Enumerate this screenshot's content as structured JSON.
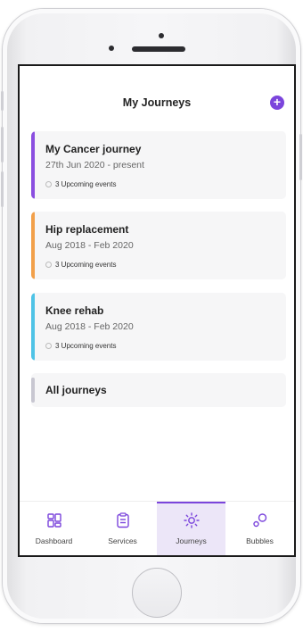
{
  "header": {
    "title": "My Journeys",
    "add_label": "+"
  },
  "journeys": [
    {
      "name": "My Cancer journey",
      "dates": "27th Jun 2020 - present",
      "events": "3 Upcoming events",
      "color": "#8b4fe0"
    },
    {
      "name": "Hip replacement",
      "dates": "Aug 2018 - Feb 2020",
      "events": "3 Upcoming events",
      "color": "#f2a04a"
    },
    {
      "name": "Knee rehab",
      "dates": "Aug 2018 - Feb 2020",
      "events": "3 Upcoming events",
      "color": "#4fc3e6"
    }
  ],
  "all_journeys": {
    "label": "All journeys"
  },
  "nav": {
    "items": [
      {
        "label": "Dashboard",
        "icon": "dashboard-icon"
      },
      {
        "label": "Services",
        "icon": "services-icon"
      },
      {
        "label": "Journeys",
        "icon": "journeys-icon",
        "active": true
      },
      {
        "label": "Bubbles",
        "icon": "bubbles-icon"
      }
    ]
  },
  "colors": {
    "accent": "#7b45dc",
    "active_tab_bg": "#ece6f8"
  }
}
